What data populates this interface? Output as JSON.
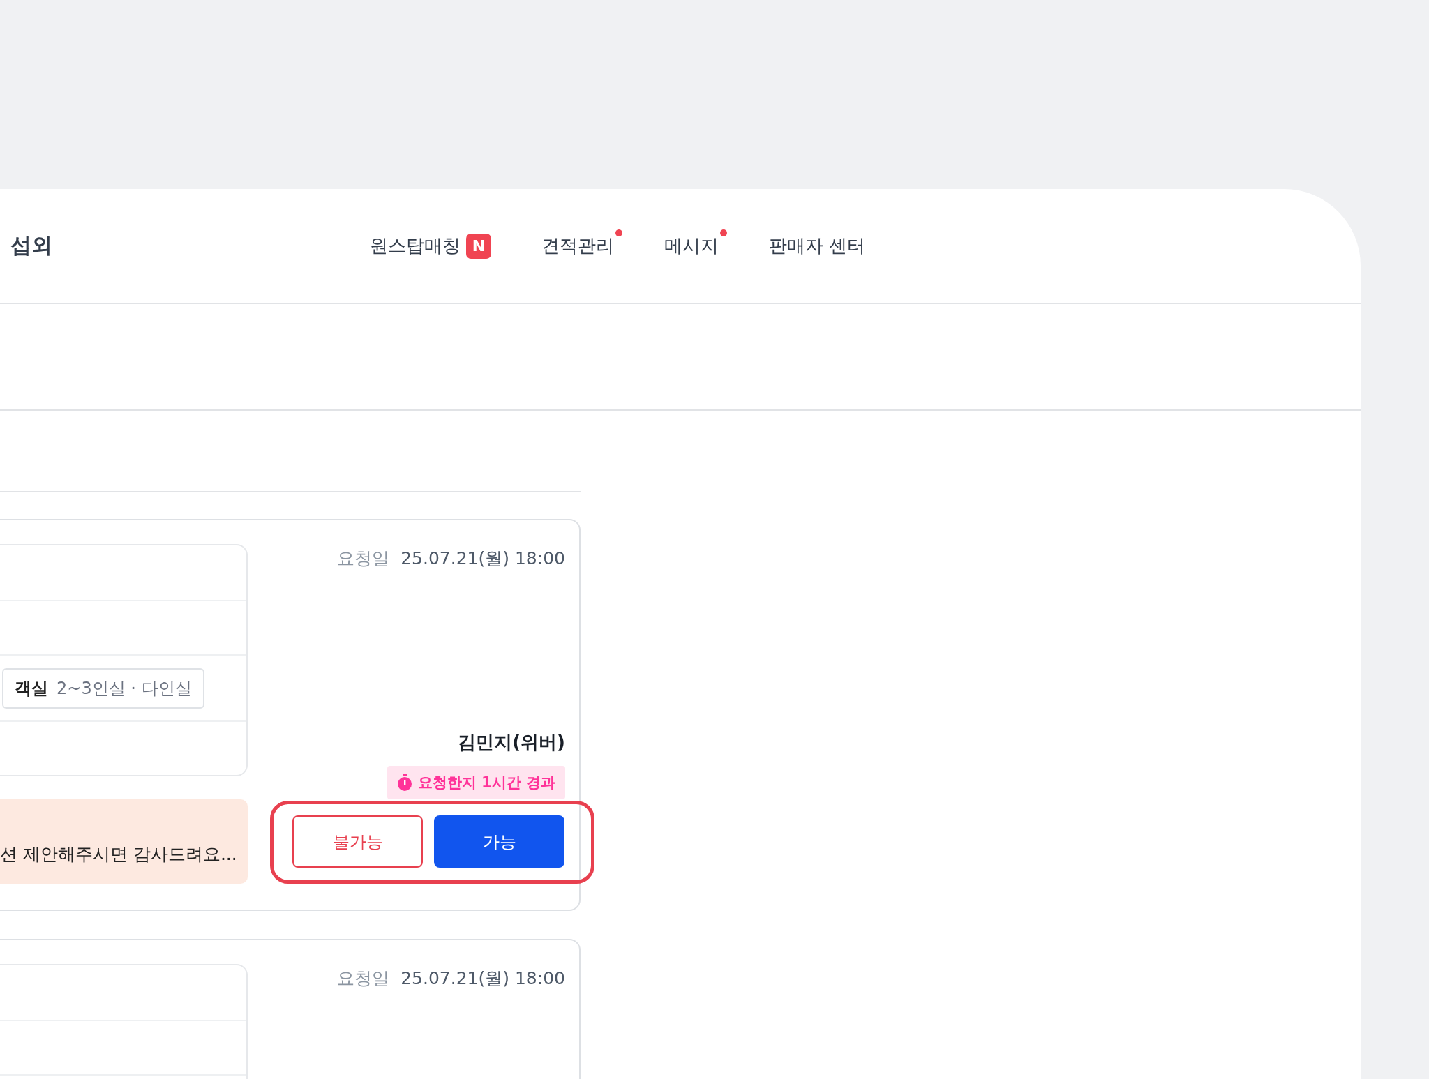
{
  "header": {
    "title": "섭외",
    "nav": [
      {
        "label": "원스탑매칭",
        "badge": "N",
        "dot": false
      },
      {
        "label": "견적관리",
        "dot": true
      },
      {
        "label": "메시지",
        "dot": true
      },
      {
        "label": "판매자 센터",
        "dot": false
      }
    ]
  },
  "requests": [
    {
      "info_rows": [
        {
          "kind": "empty"
        },
        {
          "kind": "empty"
        },
        {
          "kind": "chip",
          "chip_label": "객실",
          "chip_value": "2~3인실 · 다인실"
        },
        {
          "kind": "empty"
        }
      ],
      "message": "션 제안해주시면 감사드려요...",
      "request_label": "요청일",
      "request_date": "25.07.21(월) 18:00",
      "requester": "김민지(위버)",
      "elapsed": "요청한지 1시간 경과",
      "highlighted": true,
      "actions": [
        {
          "label": "불가능",
          "kind": "decline"
        },
        {
          "label": "가능",
          "kind": "accept"
        }
      ]
    },
    {
      "info_rows": [
        {
          "kind": "empty"
        },
        {
          "kind": "empty"
        },
        {
          "kind": "empty"
        }
      ],
      "request_label": "요청일",
      "request_date": "25.07.21(월) 18:00"
    }
  ]
}
